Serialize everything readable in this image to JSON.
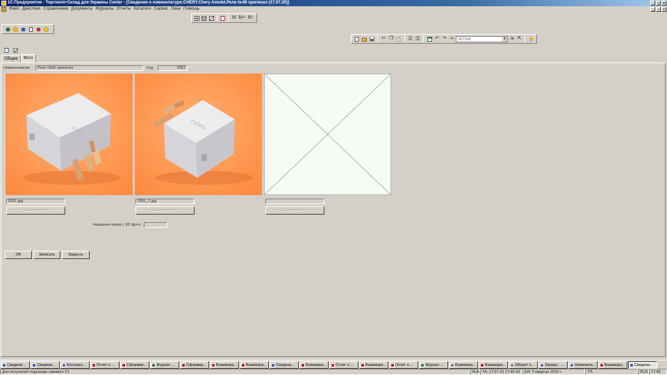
{
  "window": {
    "title": "1С:Предприятие - Торговля+Склад для Украины Center - [Сведения о номенклатуре:CHERY.Chery Amulet.Реле №49 оригинал (17.07.20)]"
  },
  "menu": [
    "Файл",
    "Действия",
    "Справочники",
    "Документы",
    "Журналы",
    "Отчеты",
    "Каталоги",
    "Сервис",
    "Окна",
    "Помощь"
  ],
  "toolbar_font": {
    "labels": [
      "M",
      "M+",
      "M-"
    ]
  },
  "toolbar_main": {
    "search_value": "307364"
  },
  "form": {
    "tabs": [
      "Общие",
      "Фото"
    ],
    "active_tab": 1,
    "name_label": "Наименование",
    "name_value": "Реле №49 оригинал",
    "code_label": "Код",
    "code_value": "9351",
    "photos": [
      {
        "filename": "9351.jpg",
        "button": "Сменить Фото",
        "has_image": true
      },
      {
        "filename": "9351_1.jpg",
        "button": "Сменить Фото",
        "has_image": true
      },
      {
        "filename": "",
        "button": "Сменить Фото",
        "has_image": false
      }
    ],
    "folder3d_label": "Название папки с 3D фото:",
    "folder3d_value": "",
    "buttons": {
      "ok": "OK",
      "save": "Записать",
      "close": "Закрыть"
    }
  },
  "taskbar": [
    {
      "label": "Сведени...",
      "icon": "form-icon",
      "active": false
    },
    {
      "label": "Сведени...",
      "icon": "form-icon",
      "active": false
    },
    {
      "label": "Контраге...",
      "icon": "list-icon",
      "active": false
    },
    {
      "label": "Отчет о ...",
      "icon": "report-icon",
      "active": false
    },
    {
      "label": "Сформир...",
      "icon": "report-icon",
      "active": false
    },
    {
      "label": "Журнал ...",
      "icon": "journal-icon",
      "active": false
    },
    {
      "label": "Сформир...",
      "icon": "report-icon",
      "active": false
    },
    {
      "label": "Взаимора...",
      "icon": "report-icon",
      "active": false
    },
    {
      "label": "Взаимора...",
      "icon": "report-icon",
      "active": false
    },
    {
      "label": "Сведени...",
      "icon": "form-icon",
      "active": false
    },
    {
      "label": "Взаимора...",
      "icon": "report-icon",
      "active": false
    },
    {
      "label": "Отчет о ...",
      "icon": "report-icon",
      "active": false
    },
    {
      "label": "Взаимора...",
      "icon": "report-icon",
      "active": false
    },
    {
      "label": "Отчет о ...",
      "icon": "report-icon",
      "active": false
    },
    {
      "label": "Журнал ...",
      "icon": "journal-icon",
      "active": false
    },
    {
      "label": "Взаимора...",
      "icon": "doc-icon",
      "active": false
    },
    {
      "label": "Взаимора...",
      "icon": "report-icon",
      "active": false
    },
    {
      "label": "Оборот п...",
      "icon": "doc-icon",
      "active": false
    },
    {
      "label": "Заказы : ...",
      "icon": "list-icon",
      "active": false
    },
    {
      "label": "Номенкла...",
      "icon": "list-icon",
      "active": false
    },
    {
      "label": "Взаимора...",
      "icon": "report-icon",
      "active": false
    },
    {
      "label": "Сведени...",
      "icon": "form-icon",
      "active": true
    }
  ],
  "statusbar": {
    "hint": "Для получения подсказки нажмите F1",
    "num": "NUM",
    "ta": "ТА: 17.07.20  17:46:43",
    "bi": "БИ: 3 квартал 2020 г.",
    "tp": "ТП:",
    "lang": "RUS",
    "time": "17:46"
  },
  "colors": {
    "titlebar": "#0a246a",
    "photo_bg": "#ff9955",
    "relay_body": "#e0dee0",
    "empty_photo_bg": "#f6fbf6"
  }
}
